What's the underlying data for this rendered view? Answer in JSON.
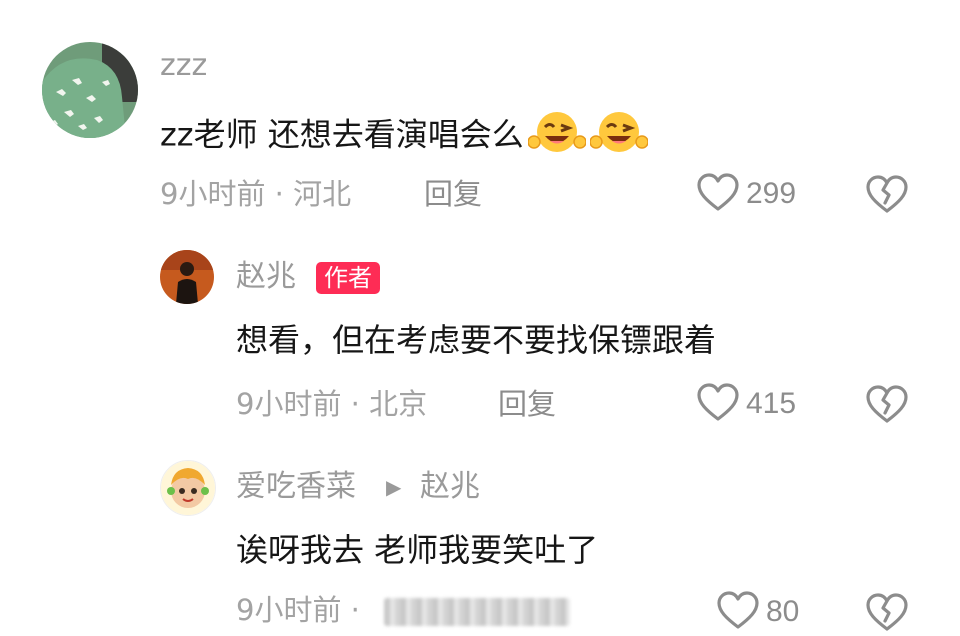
{
  "comments": [
    {
      "username": "zzz",
      "text": "zz老师 还想去看演唱会么",
      "emoji_count": 2,
      "emoji": "laughing-wink-emoji",
      "meta": "9小时前 · 河北",
      "reply_label": "回复",
      "likes": "299"
    },
    {
      "username": "赵兆",
      "badge": "作者",
      "text": "想看，但在考虑要不要找保镖跟着",
      "meta": "9小时前 · 北京",
      "reply_label": "回复",
      "likes": "415"
    },
    {
      "username": "爱吃香菜",
      "reply_to": "赵兆",
      "text": "诶呀我去 老师我要笑吐了",
      "meta": "9小时前 · ",
      "likes": "80"
    }
  ],
  "colors": {
    "badge": "#fe2c55",
    "secondary_text": "#9a9a9a",
    "primary_text": "#161616"
  },
  "icons": {
    "like": "heart-outline-icon",
    "dislike": "broken-heart-icon",
    "reply_arrow": "triangle-right-icon"
  }
}
